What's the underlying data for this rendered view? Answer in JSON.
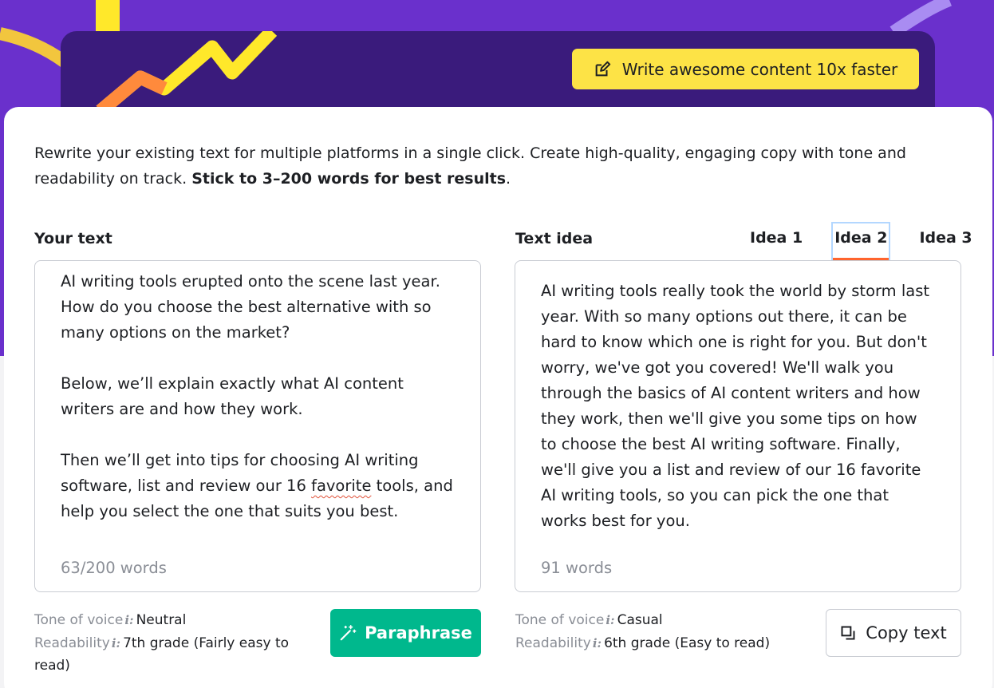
{
  "banner": {
    "cta_label": "Write awesome content 10x faster",
    "cta_icon": "edit-icon"
  },
  "intro": {
    "text": "Rewrite your existing text for multiple platforms in a single click. Create high-quality, engaging copy with tone and readability on track. ",
    "bold": "Stick to 3–200 words for best results",
    "end": "."
  },
  "input": {
    "title": "Your text",
    "para1": "AI writing tools erupted onto the scene last year. How do you choose the best alternative with so many options on the market?",
    "para2": "Below, we’ll explain exactly what AI content writers are and how they work.",
    "para3_before": "Then we’ll get into tips for choosing AI writing software, list and review our 16 ",
    "para3_flagged": "favorite",
    "para3_after": " tools, and help you select the one that suits you best.",
    "word_count": "63/200 words",
    "tone_label": "Tone of voice",
    "tone_value": "Neutral",
    "readability_label": "Readability",
    "readability_value": "7th grade (Fairly easy to read)",
    "action_label": "Paraphrase",
    "action_icon": "magic-wand-icon"
  },
  "output": {
    "title": "Text idea",
    "tabs": [
      "Idea 1",
      "Idea 2",
      "Idea 3"
    ],
    "active_tab": "Idea 2",
    "text": "AI writing tools really took the world by storm last year. With so many options out there, it can be hard to know which one is right for you. But don't worry, we've got you covered! We'll walk you through the basics of AI content writers and how they work, then we'll give you some tips on how to choose the best AI writing software. Finally, we'll give you a list and review of our 16 favorite AI writing tools, so you can pick the one that works best for you.",
    "word_count": "91 words",
    "tone_label": "Tone of voice",
    "tone_value": "Casual",
    "readability_label": "Readability",
    "readability_value": "6th grade (Easy to read)",
    "action_label": "Copy text",
    "action_icon": "copy-icon"
  },
  "info_glyph": "i:",
  "colors": {
    "hero": "#6a30cc",
    "banner": "#3a1b7c",
    "cta": "#fde346",
    "primary_button": "#00b88d",
    "active_tab_underline": "#ff642d"
  }
}
